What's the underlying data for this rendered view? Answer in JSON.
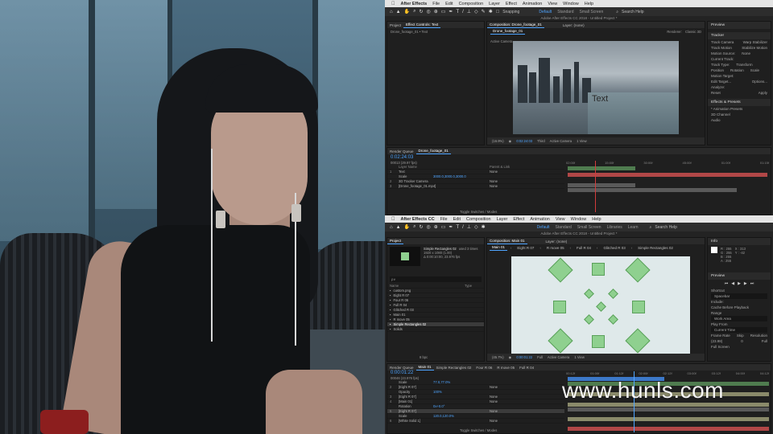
{
  "watermark": "www.hunls.com",
  "top_window": {
    "menubar": {
      "app": "After Effects",
      "items": [
        "File",
        "Edit",
        "Composition",
        "Layer",
        "Effect",
        "Animation",
        "View",
        "Window",
        "Help"
      ]
    },
    "toolbar": {
      "snapping": "Snapping",
      "workspaces": [
        "Default",
        "Standard",
        "Small Screen"
      ],
      "search": "Search Help"
    },
    "title": "Adobe After Effects CC 2018 - Untitled Project *",
    "project_tab": "Project",
    "effect_controls_tab": "Effect Controls: Text",
    "effect_controls_sub": "Drone_footage_01 • Text",
    "comp_tab": "Composition: Drone_footage_01",
    "layer_tab": "Layer: (none)",
    "comp_sub": "Drone_footage_01",
    "renderer": "Renderer:",
    "renderer_value": "Classic 3D",
    "active_camera": "Active Camera",
    "viewer_text": "Text",
    "viewer_footer": {
      "zoom": "(16.9%)",
      "time": "0:02:24:03",
      "quality": "Third",
      "camera": "Active Camera",
      "views": "1 View"
    },
    "right_panel": {
      "preview": "Preview",
      "tracker": "Tracker",
      "track_camera": "Track Camera",
      "warp_stabilizer": "Warp Stabilizer",
      "track_motion": "Track Motion",
      "stabilize_motion": "Stabilize Motion",
      "motion_source": "Motion Source:",
      "motion_source_value": "None",
      "current_track": "Current Track:",
      "track_type": "Track Type:",
      "track_type_value": "Transform",
      "position": "Position",
      "rotation": "Rotation",
      "scale": "Scale",
      "motion_target": "Motion Target:",
      "edit_target": "Edit Target...",
      "options": "Options...",
      "analyze": "Analyze:",
      "reset": "Reset",
      "apply": "Apply",
      "effects_presets": "Effects & Presets",
      "animation_presets": "* Animation Presets",
      "channel_3d": "3D Channel",
      "audio": "Audio"
    },
    "timeline": {
      "render_queue": "Render Queue",
      "comp_tab": "Drone_footage_01",
      "time": "0:02:24:03",
      "frames": "00013 (29.97 fps)",
      "col_layer": "Layer Name",
      "col_parent": "Parent & Link",
      "layers": [
        {
          "num": "1",
          "name": "Text",
          "parent": "None"
        },
        {
          "num": "",
          "name": "Scale",
          "value": "3000.0,3000.0,3000.0",
          "parent": ""
        },
        {
          "num": "2",
          "name": "3D Tracker Camera",
          "parent": "None"
        },
        {
          "num": "3",
          "name": "[Drone_footage_01.mp4]",
          "parent": "None"
        }
      ],
      "ruler": [
        "02:00f",
        "15:00f",
        "30:00f",
        "45:00f",
        "01:00f",
        "01:15f"
      ],
      "footer": "Toggle Switches / Modes"
    }
  },
  "bottom_window": {
    "menubar": {
      "app": "After Effects CC",
      "items": [
        "File",
        "Edit",
        "Composition",
        "Layer",
        "Effect",
        "Animation",
        "View",
        "Window",
        "Help"
      ]
    },
    "toolbar": {
      "workspaces": [
        "Default",
        "Standard",
        "Small Screen",
        "Libraries",
        "Learn"
      ],
      "search": "Search Help"
    },
    "title": "Adobe After Effects CC 2018 - Untitled Project *",
    "project": {
      "tab": "Project",
      "selected": "Simple Rectangles 02",
      "selected_meta": "used 3 times",
      "selected_size": "1920 x 1080 (1.00)",
      "selected_time": "Δ 0:00:10:00, 23.976 fps",
      "search_placeholder": "ρ∨",
      "col_name": "Name",
      "col_type": "Type",
      "items": [
        "custom.png",
        "Eight R 07",
        "Four R 06",
        "Full R 04",
        "Glitched R 03",
        "Main 01",
        "R move 05",
        "Simple Rectangles 02",
        "Solids"
      ],
      "bpc": "8 bpc"
    },
    "comp": {
      "tab": "Composition: Main 01",
      "layer_tab": "Layer: (none)",
      "flow": [
        "Main 01",
        "Eight R 07",
        "R move 05",
        "Full R 04",
        "Glitched R 03",
        "Simple Rectangles 02"
      ],
      "footer": {
        "zoom": "(45.7%)",
        "time": "0:00:01:22",
        "quality": "Full",
        "camera": "Active Camera",
        "views": "1 View"
      }
    },
    "info": {
      "tab": "Info",
      "r": "R : 255",
      "g": "G : 255",
      "b": "B : 255",
      "a": "A : 255",
      "x": "X : 313",
      "y": "Y : -42",
      "preview": "Preview",
      "shortcut": "Shortcut",
      "shortcut_value": "Spacebar",
      "include": "Include:",
      "cache": "Cache Before Playback",
      "range": "Range",
      "range_value": "Work Area",
      "play_from": "Play From",
      "play_from_value": "Current Time",
      "frame_rate": "Frame Rate",
      "skip": "Skip",
      "resolution": "Resolution",
      "fr_value": "(23.98)",
      "skip_value": "0",
      "res_value": "Full",
      "full_screen": "Full Screen"
    },
    "timeline": {
      "render_queue": "Render Queue",
      "tabs": [
        "Main 01",
        "Simple Rectangles 02",
        "Four R 06",
        "R move 05",
        "Full R 04"
      ],
      "time": "0:00:01:22",
      "frames": "00046 (23.976 fps)",
      "layers": [
        {
          "num": "",
          "name": "Scale",
          "value": "77.0,77.0%"
        },
        {
          "num": "2",
          "name": "[Eight R 07]",
          "parent": "None"
        },
        {
          "num": "",
          "name": "Opacity",
          "value": "100%"
        },
        {
          "num": "3",
          "name": "[Eight R 07]",
          "parent": "None"
        },
        {
          "num": "4",
          "name": "[Main 01]",
          "parent": "None"
        },
        {
          "num": "",
          "name": "Rotation",
          "value": "0x+0.0°"
        },
        {
          "num": "5",
          "name": "[Eight R 07]",
          "parent": "None"
        },
        {
          "num": "",
          "name": "Scale",
          "value": "120.0,120.0%"
        },
        {
          "num": "6",
          "name": "[White Solid 1]",
          "parent": "None"
        }
      ],
      "ruler": [
        "00:12f",
        "01:00f",
        "01:12f",
        "02:00f",
        "02:12f",
        "03:00f",
        "03:12f",
        "04:00f",
        "04:12f"
      ],
      "footer": "Toggle Switches / Modes"
    }
  },
  "colors": {
    "accent": "#4ea4ff",
    "shape_green": "#8fd08f",
    "track_red": "#b14747",
    "track_green": "#4f7c4f",
    "track_gray": "#5a5a5a"
  }
}
